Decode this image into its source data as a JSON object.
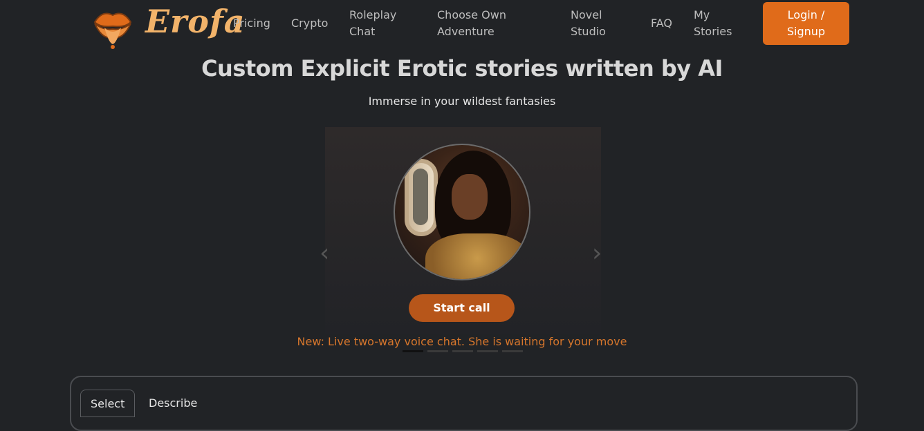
{
  "brand": {
    "name": "Erofa",
    "accent": "#e06b1a",
    "logo_color": "#f2b36a"
  },
  "nav": {
    "pricing": "Pricing",
    "crypto": "Crypto",
    "roleplay_line1": "Roleplay",
    "roleplay_line2": "Chat",
    "cyoa_line1": "Choose Own",
    "cyoa_line2": "Adventure",
    "novel_line1": "Novel",
    "novel_line2": "Studio",
    "faq": "FAQ",
    "mystories_line1": "My",
    "mystories_line2": "Stories",
    "login_line1": "Login /",
    "login_line2": "Signup"
  },
  "hero": {
    "title": "Custom Explicit Erotic stories written by AI",
    "subtitle": "Immerse in your wildest fantasies"
  },
  "carousel": {
    "prev_icon": "chevron-left-icon",
    "next_icon": "chevron-right-icon",
    "call_label": "Start call",
    "caption": "New: Live two-way voice chat. She is waiting for your move",
    "slides": 5,
    "active_slide": 1
  },
  "panel": {
    "tabs": [
      "Select",
      "Describe"
    ],
    "active_tab": "Select"
  }
}
